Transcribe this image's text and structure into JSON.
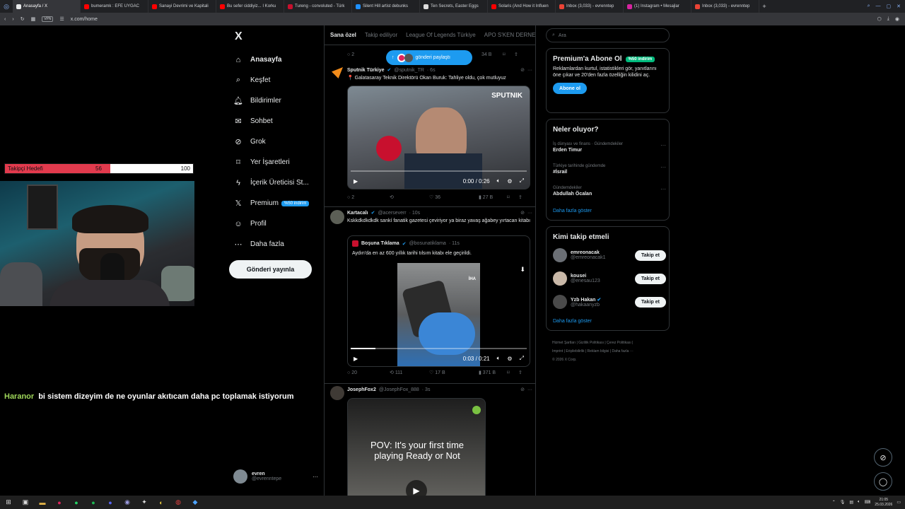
{
  "browser": {
    "tabs": [
      {
        "label": "Anasayfa / X",
        "active": true,
        "color": "#e7e9ea"
      },
      {
        "label": "bumeramk : EFE UYGAC",
        "color": "#ff0000"
      },
      {
        "label": "Sanayi Devrimi ve Kapitali",
        "color": "#ff0000"
      },
      {
        "label": "Bu sefer ciddiyiz... I Korku",
        "color": "#ff0000"
      },
      {
        "label": "Tureng - convoluted - Türk",
        "color": "#c8102e"
      },
      {
        "label": "Silent Hill artist debunks",
        "color": "#1e90ff"
      },
      {
        "label": "Ten Secrets, Easter Eggs",
        "color": "#dddddd"
      },
      {
        "label": "Solaris (And How it Influen",
        "color": "#ff0000"
      },
      {
        "label": "Inbox (3,033) - evrenntep",
        "color": "#ea4335"
      },
      {
        "label": "(1) Instagram • Mesajlar",
        "color": "#d6249f"
      },
      {
        "label": "Inbox (3,033) - evrenntep",
        "color": "#ea4335"
      }
    ],
    "new_tab": "+",
    "url": "x.com/home",
    "vpn": "VPN"
  },
  "overlay": {
    "goal_label": "Takipçi Hedefi",
    "goal_current": "56",
    "goal_target": "100",
    "goal_fraction": 0.56,
    "chat_user": "Haranor",
    "chat_message": "bi sistem dizeyim de ne oyunlar akıtıcam daha pc toplamak istiyorum"
  },
  "nav": {
    "logo": "X",
    "items": [
      {
        "label": "Anasayfa",
        "icon": "home-icon",
        "glyph": "⌂"
      },
      {
        "label": "Keşfet",
        "icon": "search-icon",
        "glyph": "⌕"
      },
      {
        "label": "Bildirimler",
        "icon": "bell-icon",
        "glyph": "🔔︎"
      },
      {
        "label": "Sohbet",
        "icon": "mail-icon",
        "glyph": "✉"
      },
      {
        "label": "Grok",
        "icon": "grok-icon",
        "glyph": "⊘"
      },
      {
        "label": "Yer İşaretleri",
        "icon": "bookmark-icon",
        "glyph": "⌑"
      },
      {
        "label": "İçerik Üreticisi St...",
        "icon": "lightning-icon",
        "glyph": "ϟ"
      },
      {
        "label": "Premium",
        "icon": "x-premium-icon",
        "glyph": "𝕏"
      },
      {
        "label": "Profil",
        "icon": "person-icon",
        "glyph": "☺"
      },
      {
        "label": "Daha fazla",
        "icon": "more-circle-icon",
        "glyph": "⋯"
      }
    ],
    "premium_badge": "%50 indirim",
    "post_button": "Gönderi yayınla",
    "account_name": "evren",
    "account_handle": "@evrenntepe",
    "account_more": "···"
  },
  "timeline": {
    "tabs": [
      "Sana özel",
      "Takip ediliyor",
      "League Of Legends Türkiye",
      "APO S'KEN DERNE"
    ],
    "toast": "gönderi paylaştı",
    "top_actions": {
      "replies": "2",
      "views": "34 B"
    },
    "posts": [
      {
        "name": "Sputnik Türkiye",
        "handle": "@sputnik_TR",
        "time": "· 6s",
        "text": "📍 Galatasaray Teknik Direktörü Okan Buruk: Tahliye oldu, çok mutluyuz",
        "watermark": "SPUTNIK",
        "video_time": "0:00 / 0:26",
        "replies": "2",
        "reposts": "",
        "likes": "36",
        "views": "27 B"
      },
      {
        "name": "Kartacalı",
        "handle": "@acerseverr",
        "time": "· 10s",
        "text": "Kskkdkdkdkdk sankí fanatik gazetesi çeviriyor ya biraz yavaş ağabey yırtacan kitabı",
        "quote_name": "Boşuna Tıklama",
        "quote_handle": "@bosunatiklama",
        "quote_time": "· 11s",
        "quote_text": "Aydın'da en az 600 yıllık tarihi tılsım kitabı ele geçirildi.",
        "video_time": "0:03 / 0:21",
        "progress": 0.14,
        "video_logo": "İHA",
        "replies": "20",
        "reposts": "111",
        "likes": "17 B",
        "views": "371 B"
      },
      {
        "name": "JosephFox2",
        "handle": "@JosephFox_888",
        "time": "· 3s",
        "video_text": "POV: It's your first time playing Ready or Not"
      }
    ]
  },
  "right": {
    "search_placeholder": "Ara",
    "premium_title": "Premium'a Abone Ol",
    "premium_badge": "%50 indirim",
    "premium_text": "Reklamlardan kurtul, istatistikleri gör, yanıtlarını öne çıkar ve 20'den fazla özelliğin kilidini aç.",
    "premium_button": "Abone ol",
    "trends_title": "Neler oluyor?",
    "trends": [
      {
        "category": "İş dünyası ve finans · Gündemdekiler",
        "title": "Erden Timur"
      },
      {
        "category": "Türkiye tarihinde gündemde",
        "title": "#İsrail"
      },
      {
        "category": "Gündemdekiler",
        "title": "Abdullah Öcalan"
      }
    ],
    "trends_more": "Daha fazla göster",
    "follow_title": "Kimi takip etmeli",
    "follow": [
      {
        "name": "emreonacak",
        "handle": "@emreonacak1",
        "verified": false
      },
      {
        "name": "kousei",
        "handle": "@enesau123",
        "verified": false
      },
      {
        "name": "Yzb Hakan",
        "handle": "@hakaanyzb",
        "verified": true
      }
    ],
    "follow_button": "Takip et",
    "follow_more": "Daha fazla göster",
    "footer_line1": "Hizmet Şartları  |  Gizlilik Politikası  |  Çerez Politikası  |",
    "footer_line2": "Imprint  |  Erişilebilirlik  |  Reklam bilgisi  |  Daha fazla ···",
    "footer_line3": "© 2026 X Corp."
  },
  "taskbar": {
    "time": "21:05",
    "date": "25.03.2026"
  },
  "colors": {
    "accent": "#1d9bf0",
    "background": "#000000",
    "border": "#2f3336",
    "goal": "#e23a4d"
  }
}
